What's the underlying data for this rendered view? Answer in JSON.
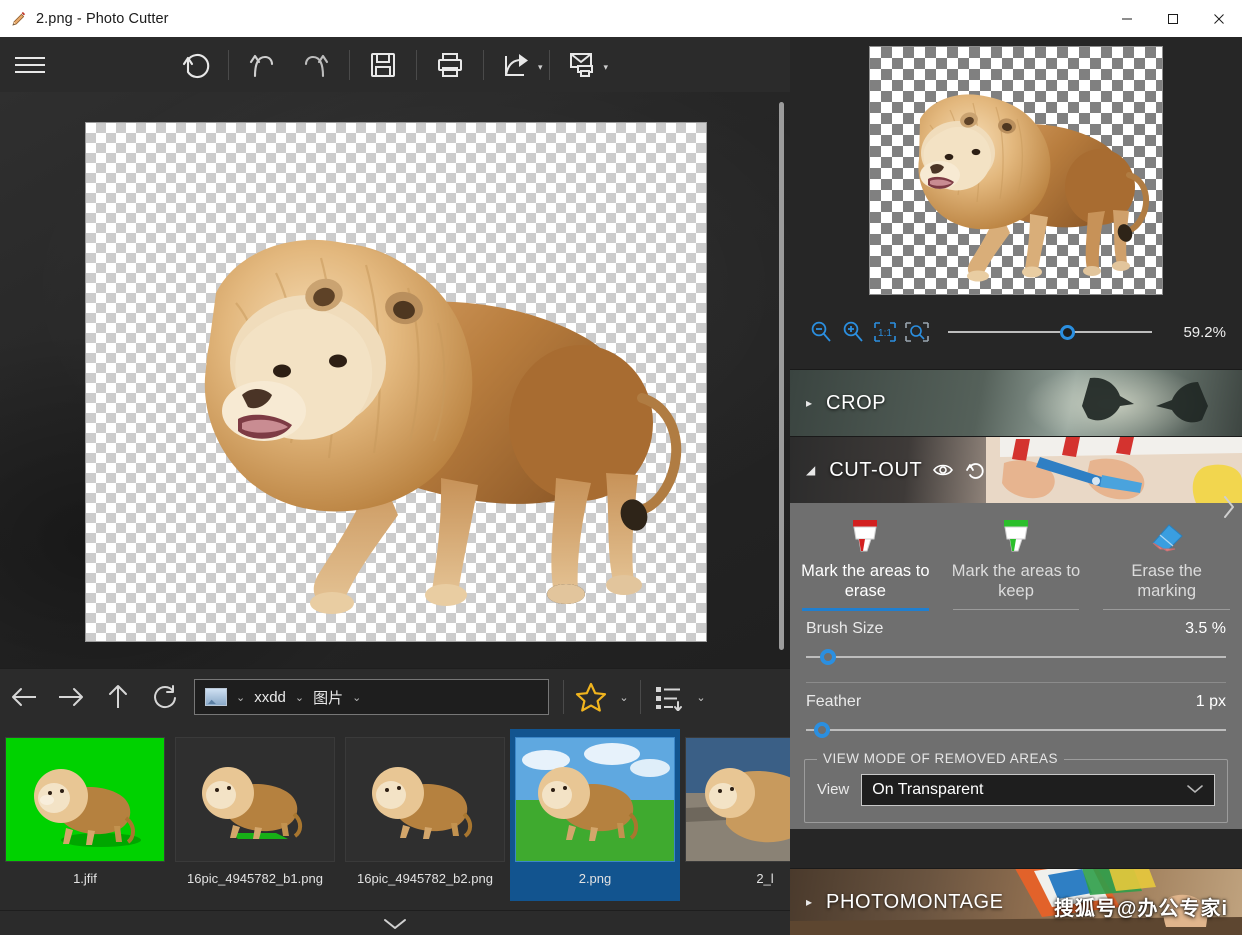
{
  "window": {
    "title": "2.png - Photo Cutter",
    "icon": "pencil-icon",
    "minimize": "–",
    "maximize": "□",
    "close": "✕"
  },
  "toolbar": {
    "menu": "hamburger-menu-icon",
    "items": [
      {
        "name": "revert-icon",
        "label": "Revert"
      },
      {
        "name": "undo-icon",
        "label": "Undo"
      },
      {
        "name": "redo-icon",
        "label": "Redo"
      },
      {
        "name": "save-icon",
        "label": "Save"
      },
      {
        "name": "print-icon",
        "label": "Print"
      },
      {
        "name": "share-icon",
        "label": "Share"
      },
      {
        "name": "send-print-icon",
        "label": "Send to print"
      }
    ],
    "caret": "▾"
  },
  "preview": {
    "zoom_out": "zoom-out-icon",
    "zoom_in": "zoom-in-icon",
    "actual_size": "1:1",
    "fit_window": "fit-to-window-icon",
    "zoom_value": "59.2%",
    "zoom_percent": 59.2,
    "collapse": "⌃"
  },
  "sections": {
    "crop": {
      "title": "CROP",
      "expanded": false,
      "triangle": "▸"
    },
    "cutout": {
      "title": "CUT-OUT",
      "expanded": true,
      "triangle": "◢",
      "preview_icon": "eye-icon",
      "reset_icon": "reset-icon"
    },
    "photomontage": {
      "title": "PHOTOMONTAGE",
      "expanded": false,
      "triangle": "▸"
    }
  },
  "cutout": {
    "tools": [
      {
        "label": "Mark the areas to erase",
        "icon": "red-marker-icon",
        "active": true
      },
      {
        "label": "Mark the areas to keep",
        "icon": "green-marker-icon",
        "active": false
      },
      {
        "label": "Erase the marking",
        "icon": "eraser-icon",
        "active": false
      }
    ],
    "brush_size": {
      "label": "Brush Size",
      "value": "3.5 %",
      "percent": 3.5
    },
    "feather": {
      "label": "Feather",
      "value": "1 px",
      "percent": 2
    },
    "view_mode": {
      "legend": "VIEW MODE OF REMOVED AREAS",
      "label": "View",
      "selected": "On Transparent",
      "caret": "⌄"
    }
  },
  "file_browser": {
    "nav": [
      {
        "name": "back-button",
        "glyph": "←"
      },
      {
        "name": "forward-button",
        "glyph": "→"
      },
      {
        "name": "up-button",
        "glyph": "↑"
      },
      {
        "name": "refresh-button",
        "glyph": "↻"
      }
    ],
    "breadcrumb": {
      "icon": "picture-icon",
      "segments": [
        "xxdd",
        "图片"
      ],
      "chevron": "⌄"
    },
    "favorites_icon": "star-icon",
    "sort_icon": "sort-list-icon",
    "caret": "⌄",
    "expand": "⌄",
    "thumbnails": [
      {
        "label": "1.jfif",
        "selected": false,
        "kind": "greenscreen"
      },
      {
        "label": "16pic_4945782_b1.png",
        "selected": false,
        "kind": "cutout-green-shadow"
      },
      {
        "label": "16pic_4945782_b2.png",
        "selected": false,
        "kind": "cutout"
      },
      {
        "label": "2.png",
        "selected": true,
        "kind": "grass"
      },
      {
        "label": "2_l",
        "selected": false,
        "kind": "rock"
      }
    ]
  },
  "panel_arrow": "›",
  "watermark": "搜狐号@办公专家i",
  "colors": {
    "accent": "#2b8fe0",
    "selection": "#12548f",
    "panel_bg": "#6f6f6f",
    "app_bg": "#262626",
    "toolbar_bg": "#2b2b2b",
    "marker_erase": "#d32020",
    "marker_keep": "#2bbf2b"
  }
}
